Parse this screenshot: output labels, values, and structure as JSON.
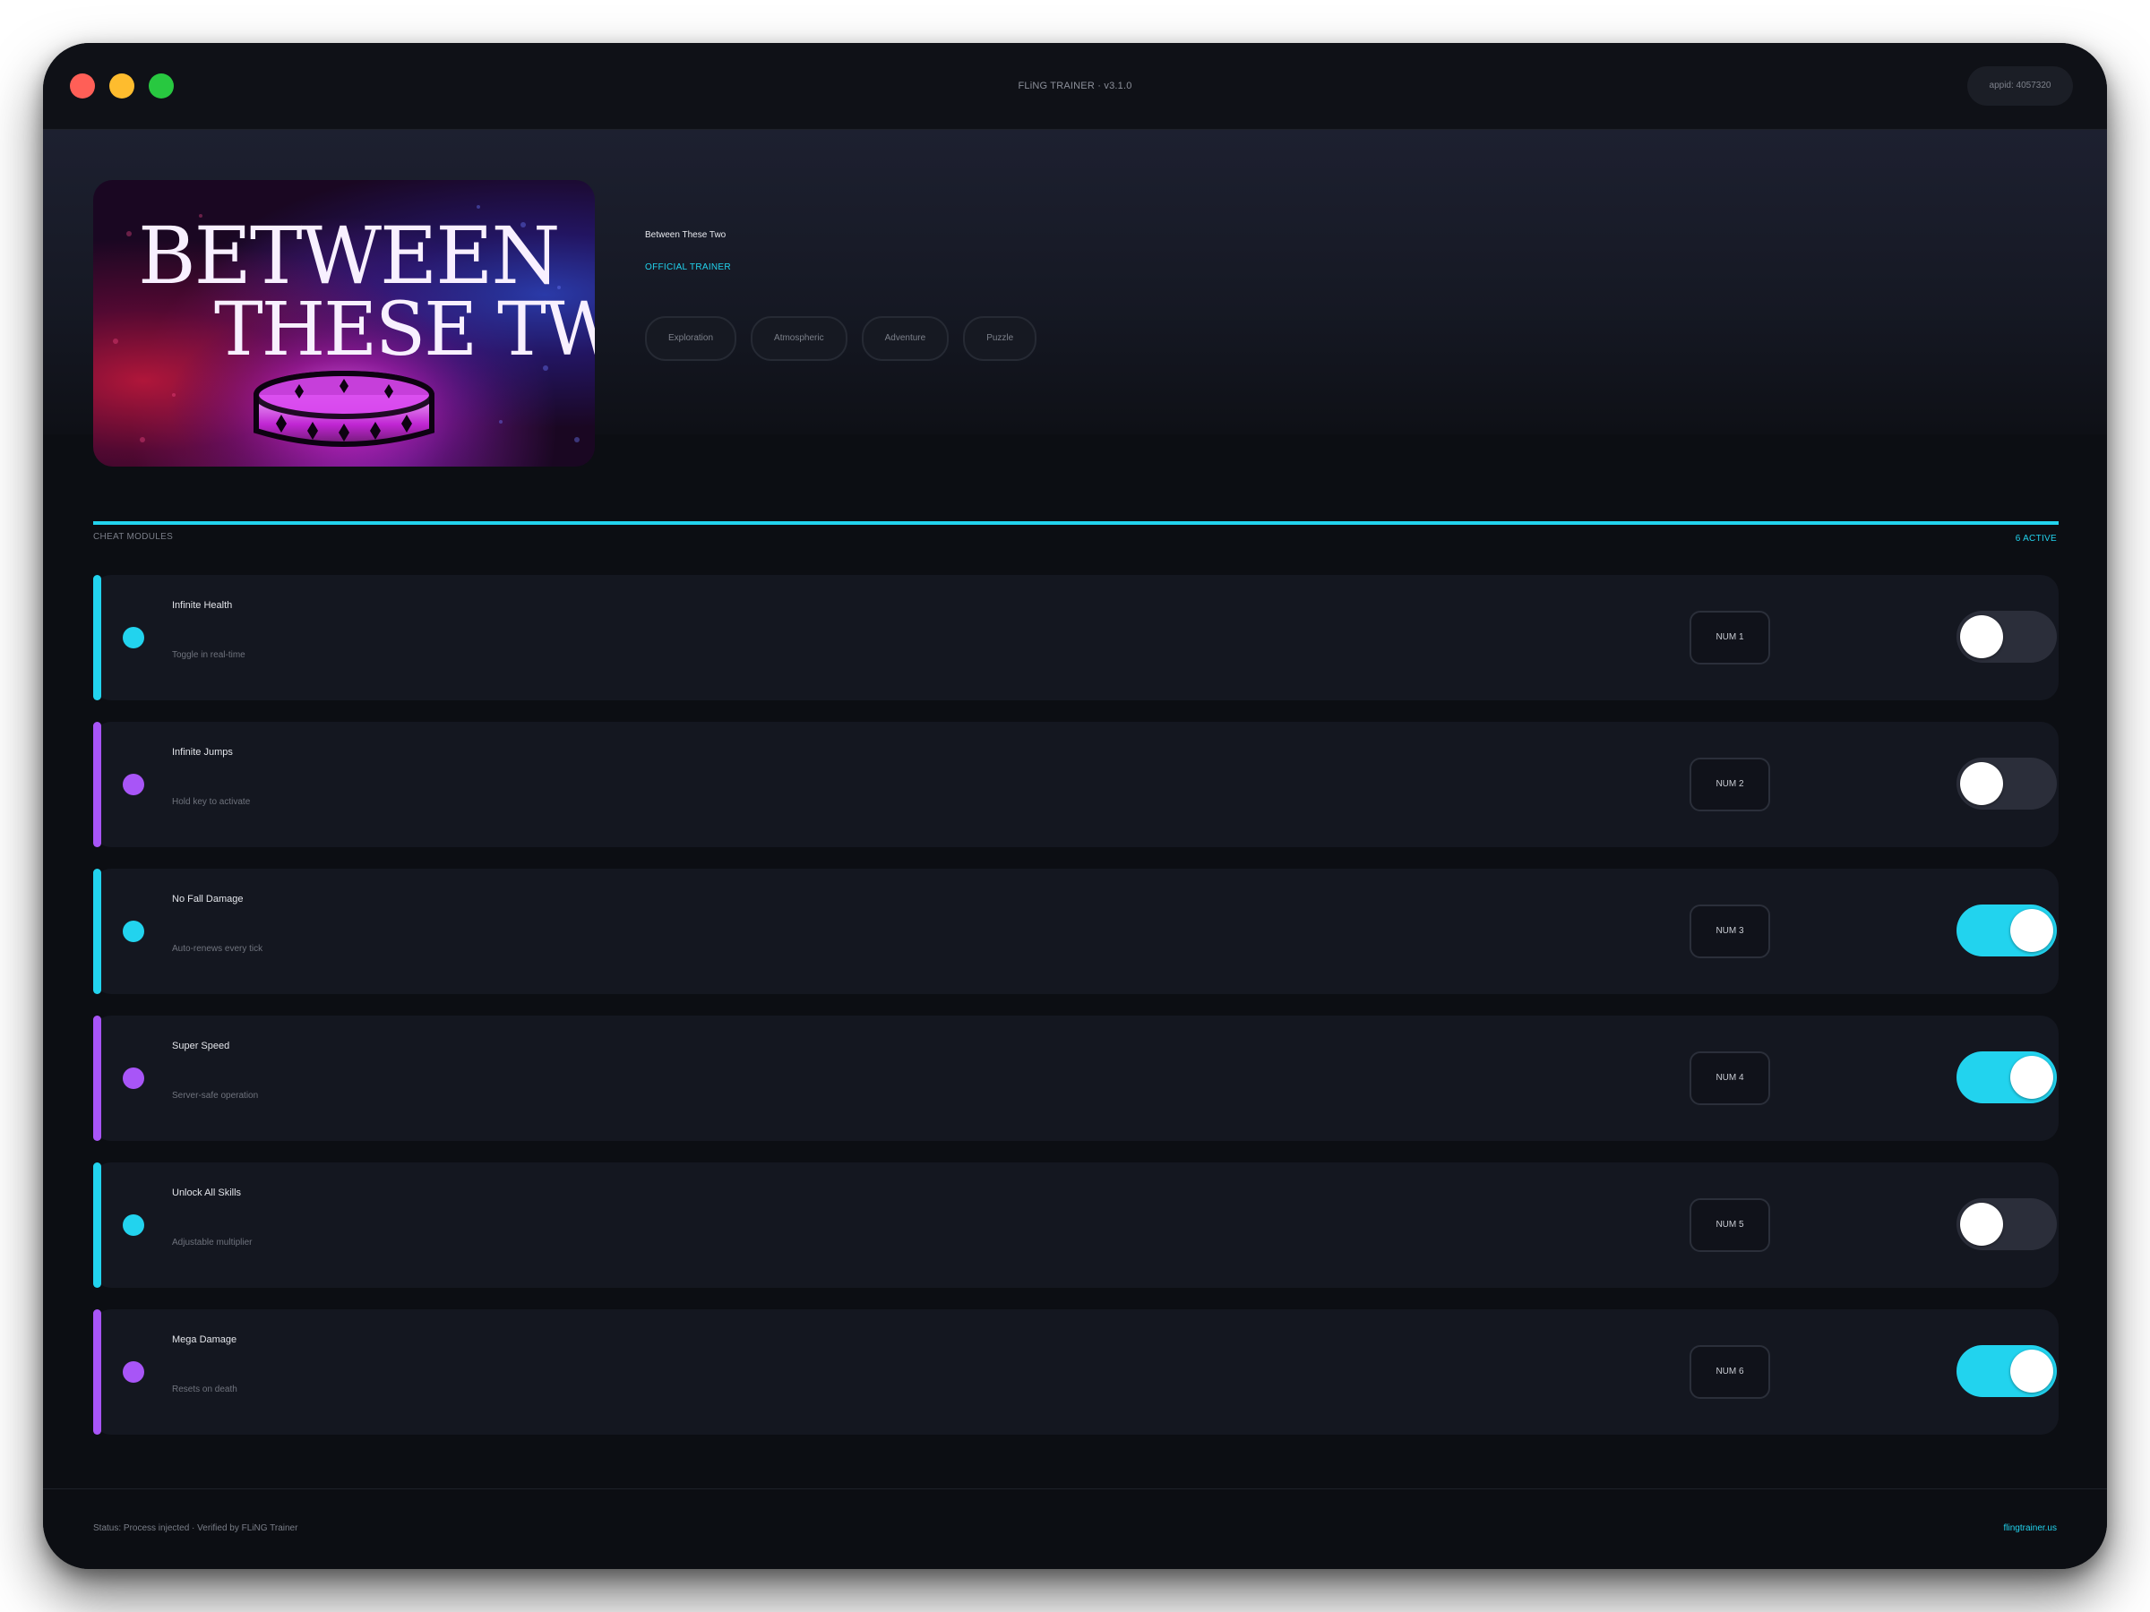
{
  "window": {
    "title": "FLiNG TRAINER · v3.1.0",
    "appid": "appid: 4057320"
  },
  "game": {
    "title": "Between These Two",
    "cover_text_line1": "BETWEEN",
    "cover_text_line2": "THESE TWO",
    "badge": "OFFICIAL TRAINER",
    "tags": [
      "Exploration",
      "Atmospheric",
      "Adventure",
      "Puzzle"
    ]
  },
  "section": {
    "label": "CHEAT MODULES",
    "active_count": "6 ACTIVE"
  },
  "colors": {
    "accent_cyan": "#22d3ee",
    "accent_purple": "#a855f7",
    "toggle_off": "#2b2e3a"
  },
  "cheats": [
    {
      "name": "Infinite Health",
      "desc": "Toggle in real-time",
      "hotkey": "NUM 1",
      "color": "#22d3ee",
      "enabled": false
    },
    {
      "name": "Infinite Jumps",
      "desc": "Hold key to activate",
      "hotkey": "NUM 2",
      "color": "#a855f7",
      "enabled": false
    },
    {
      "name": "No Fall Damage",
      "desc": "Auto-renews every tick",
      "hotkey": "NUM 3",
      "color": "#22d3ee",
      "enabled": true
    },
    {
      "name": "Super Speed",
      "desc": "Server-safe operation",
      "hotkey": "NUM 4",
      "color": "#a855f7",
      "enabled": true
    },
    {
      "name": "Unlock All Skills",
      "desc": "Adjustable multiplier",
      "hotkey": "NUM 5",
      "color": "#22d3ee",
      "enabled": false
    },
    {
      "name": "Mega Damage",
      "desc": "Resets on death",
      "hotkey": "NUM 6",
      "color": "#a855f7",
      "enabled": true
    }
  ],
  "footer": {
    "status": "Status: Process injected · Verified by FLiNG Trainer",
    "link": "flingtrainer.us"
  }
}
